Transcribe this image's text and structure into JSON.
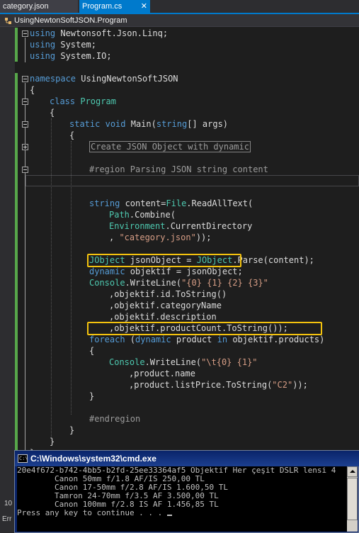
{
  "tabs": {
    "inactive_label": "category.json",
    "active_label": "Program.cs",
    "close_glyph": "✕"
  },
  "nav": {
    "label": "UsingNewtonSoftJSON.Program"
  },
  "code": {
    "l1_kw": "using",
    "l1_rest": " Newtonsoft.Json.Linq;",
    "l2_kw": "using",
    "l2_rest": " System;",
    "l3_kw": "using",
    "l3_rest": " System.IO;",
    "l5_kw": "namespace",
    "l5_rest": " UsingNewtonSoftJSON",
    "brace_open": "{",
    "brace_close": "}",
    "l7_kw": "class",
    "l7_ty": "Program",
    "l9_kw1": "static",
    "l9_kw2": "void",
    "l9_a": " Main(",
    "l9_kw3": "string",
    "l9_b": "[] args)",
    "l11_collapsed": "Create JSON Object with dynamic",
    "l13_region": "#region Parsing JSON string content",
    "l15_kw": "string",
    "l15_a": " content=",
    "l15_ty": "File",
    "l15_b": ".ReadAllText(",
    "l16_ty": "Path",
    "l16_b": ".Combine(",
    "l17_ty": "Environment",
    "l17_b": ".CurrentDirectory",
    "l18_a": ", ",
    "l18_st": "\"category.json\"",
    "l18_b": "));",
    "l20_ty": "JObject",
    "l20_a": " jsonObject = ",
    "l20_ty2": "JObject",
    "l20_b": ".Parse(content);",
    "l21_kw": "dynamic",
    "l21_rest": " objektif = jsonObject;",
    "l22_ty": "Console",
    "l22_a": ".WriteLine(",
    "l22_st": "\"{0} {1} {2} {3}\"",
    "l23": ",objektif.id.ToString()",
    "l24": ",objektif.categoryName",
    "l25": ",objektif.description",
    "l26": ",objektif.productCount.ToString());",
    "l27_kw1": "foreach",
    "l27_a": " (",
    "l27_kw2": "dynamic",
    "l27_b": " product ",
    "l27_kw3": "in",
    "l27_c": " objektif.products)",
    "l29_ty": "Console",
    "l29_a": ".WriteLine(",
    "l29_st": "\"\\t{0} {1}\"",
    "l30": ",product.name",
    "l31_a": ",product.listPrice.ToString(",
    "l31_st": "\"C2\"",
    "l31_b": "));",
    "l34_region": "#endregion"
  },
  "console": {
    "title": "C:\\Windows\\system32\\cmd.exe",
    "icon_text": "C:\\",
    "lines": [
      "20e4f672-b742-4bb5-b2fd-25ee33364af5 Objektif Her çeşit DSLR lensi 4",
      "        Canon 50mm f/1.8 AF/IS 250,00 TL",
      "        Canon 17-50mm f/2.8 AF/IS 1.600,50 TL",
      "        Tamron 24-70mm f/3.5 AF 3.500,00 TL",
      "        Canon 100mm f/2.8 IS AF 1.456,85 TL",
      "Press any key to continue . . ."
    ]
  },
  "behind": {
    "label_a": "10",
    "label_b": "Err"
  },
  "colors": {
    "keyword": "#569cd6",
    "type": "#4ec9b0",
    "string": "#d69d85",
    "highlight_box": "#f4c30e",
    "tab_active": "#007acc",
    "change_bar": "#57a64a"
  }
}
